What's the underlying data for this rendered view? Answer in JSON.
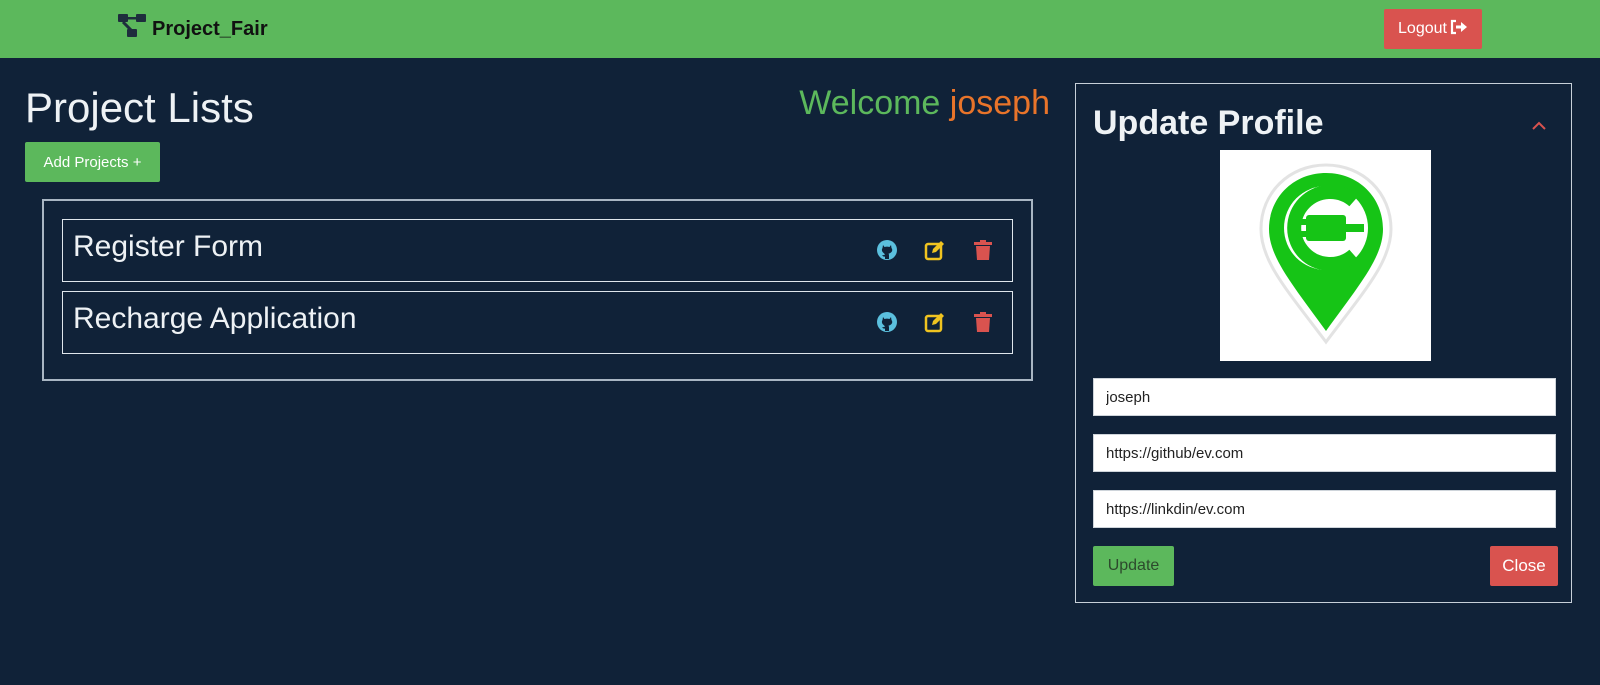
{
  "navbar": {
    "brand": "Project_Fair",
    "brand_icon": "project-diagram-icon",
    "logout_label": "Logout",
    "logout_icon": "sign-out-icon",
    "background": "#5cb85c"
  },
  "main": {
    "title": "Project Lists",
    "welcome_prefix": "Welcome",
    "welcome_user": "joseph",
    "add_button": "Add Projects +",
    "projects": [
      {
        "name": "Register Form"
      },
      {
        "name": "Recharge Application"
      }
    ],
    "action_icons": [
      "github-icon",
      "edit-icon",
      "trash-icon"
    ]
  },
  "profile": {
    "title": "Update Profile",
    "avatar_icon": "ev-charging-location-pin-icon",
    "username": "joseph",
    "github": "https://github/ev.com",
    "linkedin": "https://linkdin/ev.com",
    "update_label": "Update",
    "close_label": "Close"
  },
  "colors": {
    "page_background": "#102238",
    "success": "#5cb85c",
    "danger": "#d9534f",
    "username_accent": "#e8742a",
    "github_icon": "#5bc0de",
    "edit_icon": "#f0c420"
  }
}
